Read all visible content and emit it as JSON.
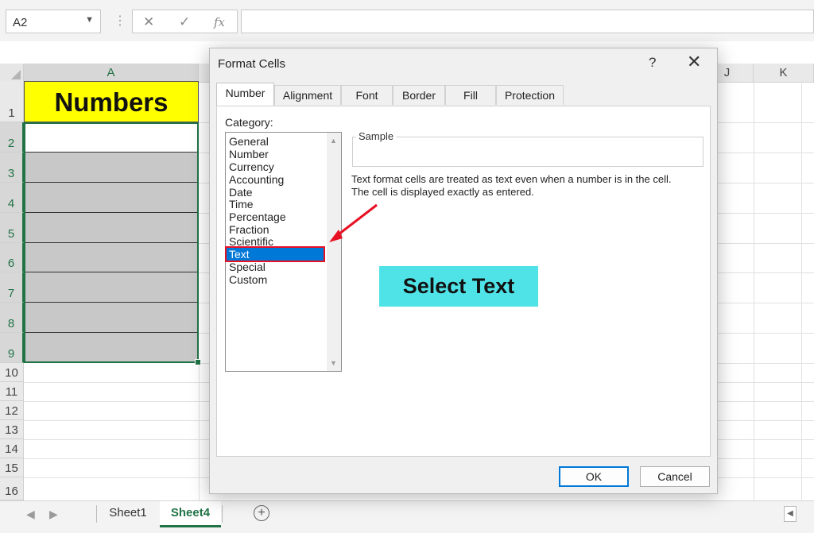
{
  "formula_bar": {
    "name_box": "A2",
    "name_caret": "▼",
    "separator": "⋮",
    "cancel_glyph": "✕",
    "enter_glyph": "✓",
    "fx_label": "fx",
    "formula_value": ""
  },
  "grid": {
    "columns": [
      "A",
      "J",
      "K"
    ],
    "rows": [
      "1",
      "2",
      "3",
      "4",
      "5",
      "6",
      "7",
      "8",
      "9",
      "10",
      "11",
      "12",
      "13",
      "14",
      "15",
      "16"
    ],
    "cell_a1": "Numbers",
    "colors": {
      "header_fill": "#ffff00",
      "selected_fill": "#c8c8c8",
      "selection_border": "#217346"
    }
  },
  "sheet_tabs": {
    "prev_icon": "◀",
    "next_icon": "▶",
    "tabs": [
      "Sheet1",
      "Sheet4"
    ],
    "active": "Sheet4",
    "add_icon": "+"
  },
  "dialog": {
    "title": "Format Cells",
    "help": "?",
    "close": "✕",
    "tabs": [
      "Number",
      "Alignment",
      "Font",
      "Border",
      "Fill",
      "Protection"
    ],
    "active_tab": "Number",
    "category_label": "Category:",
    "categories": [
      "General",
      "Number",
      "Currency",
      "Accounting",
      "Date",
      "Time",
      "Percentage",
      "Fraction",
      "Scientific",
      "Text",
      "Special",
      "Custom"
    ],
    "selected_category": "Text",
    "scroll_up": "▲",
    "scroll_down": "▼",
    "sample_label": "Sample",
    "description_line1": "Text format cells are treated as text even when a number is in the cell.",
    "description_line2": "The cell is displayed exactly as entered.",
    "ok_label": "OK",
    "cancel_label": "Cancel"
  },
  "annotation": {
    "callout_text": "Select Text",
    "callout_color": "#4fe3e8",
    "arrow_color": "#e81123"
  }
}
